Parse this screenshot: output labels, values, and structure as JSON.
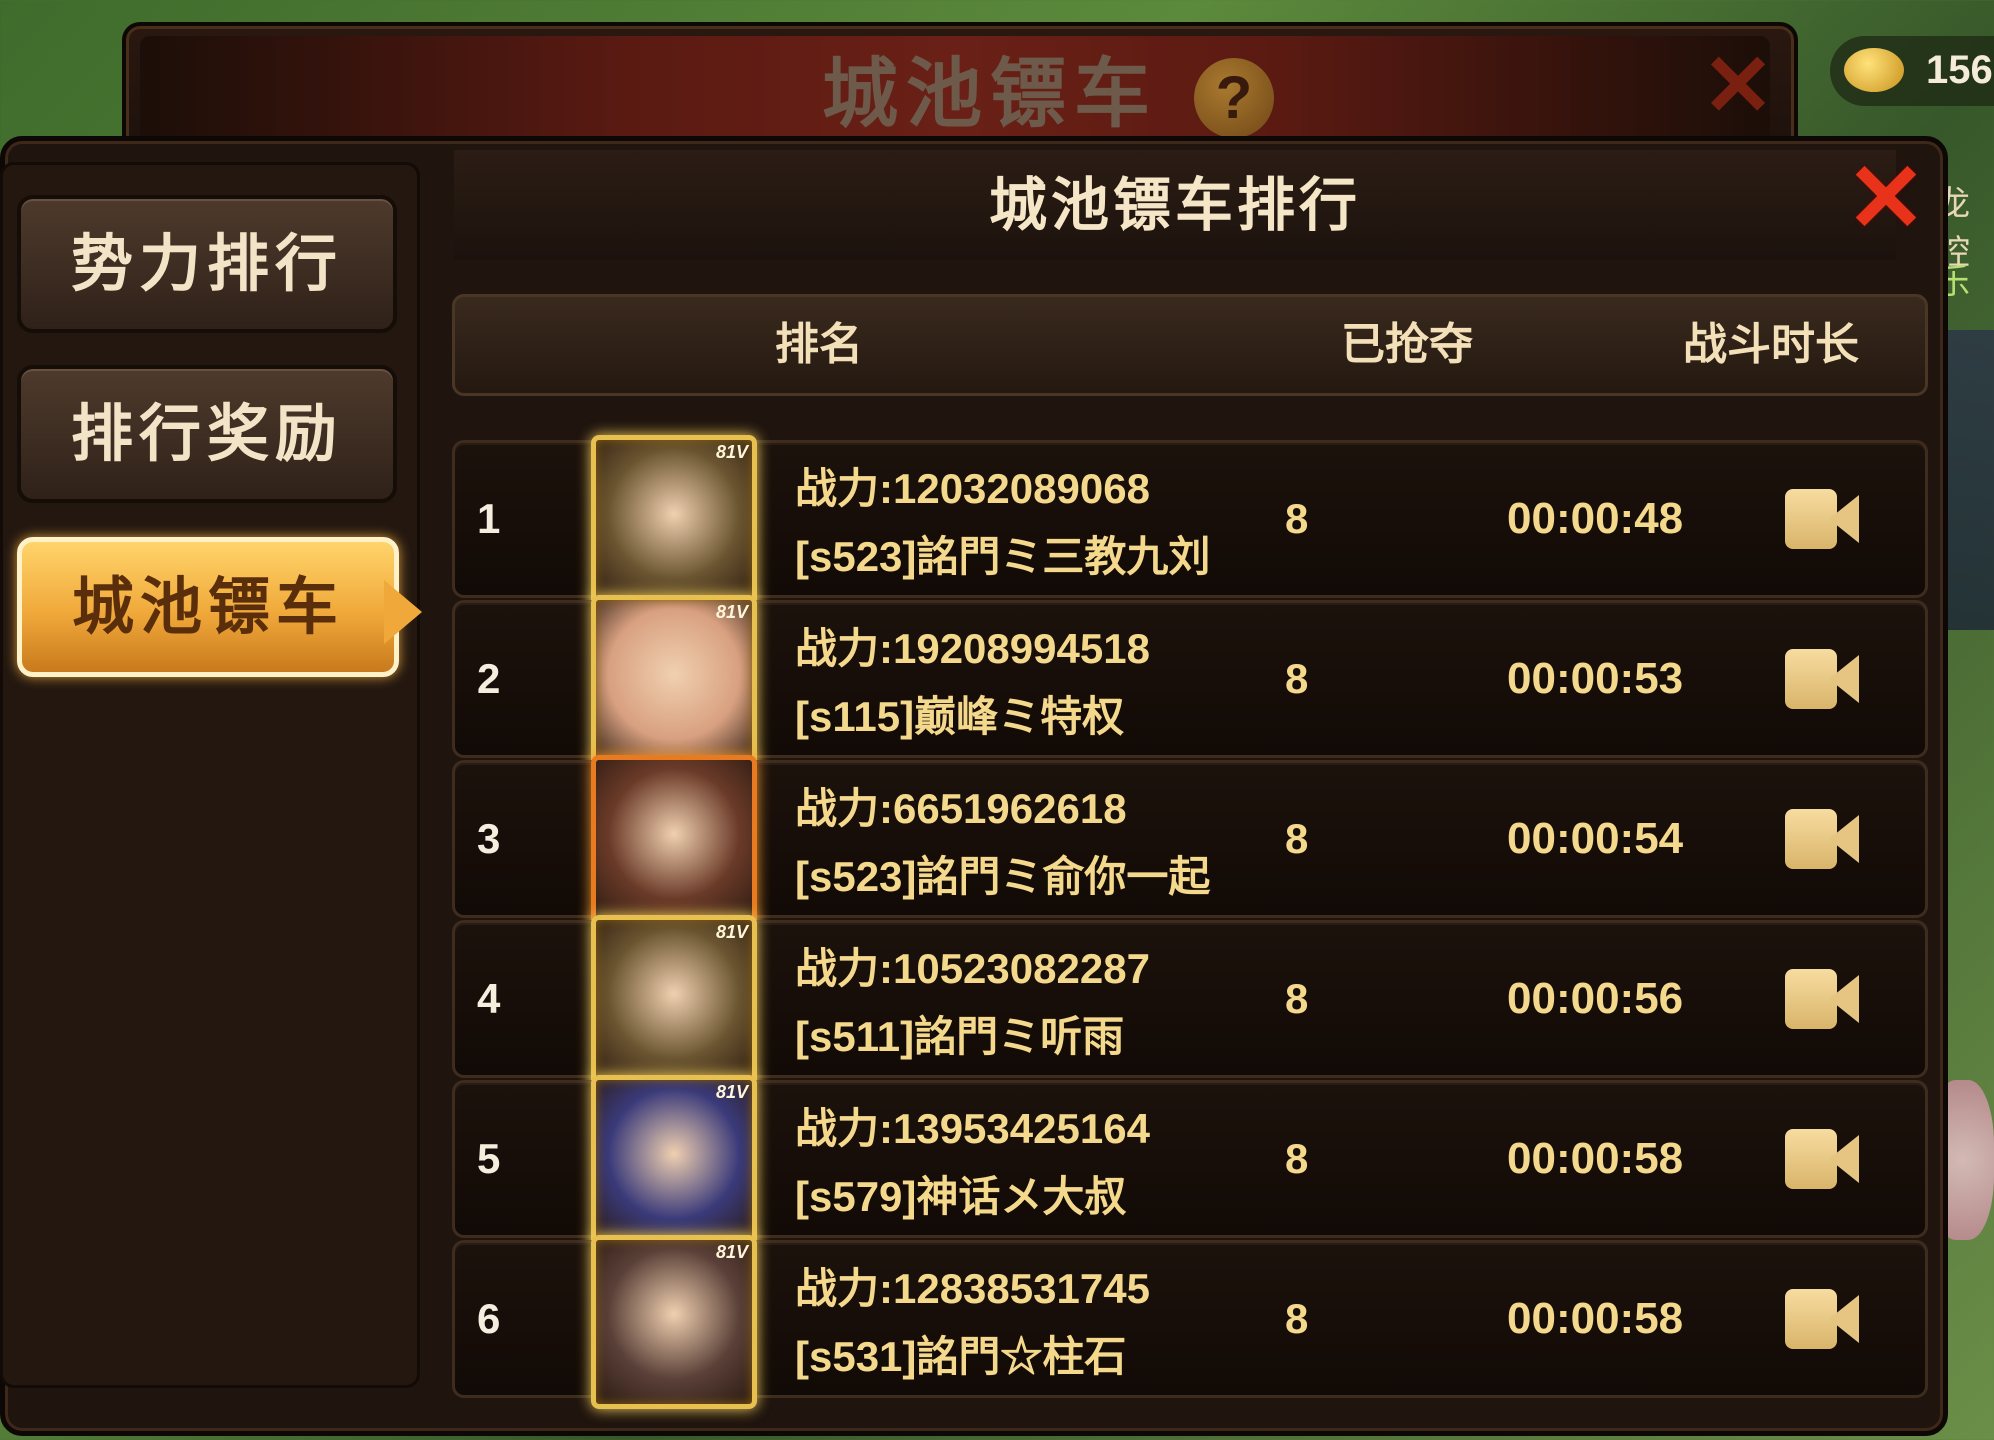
{
  "background_window": {
    "title": "城池镖车",
    "help_label": "?",
    "close_label": "✕"
  },
  "gold": {
    "icon": "gold-ingot-icon",
    "value": "156"
  },
  "side_peek": {
    "text1": "龙腔",
    "text2": "乐"
  },
  "nav": {
    "items": [
      {
        "label": "势力排行",
        "active": false
      },
      {
        "label": "排行奖励",
        "active": false
      },
      {
        "label": "城池镖车",
        "active": true
      }
    ]
  },
  "panel": {
    "title": "城池镖车排行",
    "close_label": "✕"
  },
  "columns": {
    "rank": "排名",
    "plundered": "已抢夺",
    "duration": "战斗时长"
  },
  "avatar_level": "81V",
  "rows": [
    {
      "rank": "1",
      "power": "战力:12032089068",
      "name": "[s523]詺門ミ三教九刘",
      "plundered": "8",
      "duration": "00:00:48",
      "avatar_color": "#6a5430"
    },
    {
      "rank": "2",
      "power": "战力:19208994518",
      "name": "[s115]巅峰ミ特权",
      "plundered": "8",
      "duration": "00:00:53",
      "avatar_color": "#d8a080"
    },
    {
      "rank": "3",
      "power": "战力:6651962618",
      "name": "[s523]詺門ミ俞你一起",
      "plundered": "8",
      "duration": "00:00:54",
      "avatar_color": "#6a3a28"
    },
    {
      "rank": "4",
      "power": "战力:10523082287",
      "name": "[s511]詺門ミ听雨",
      "plundered": "8",
      "duration": "00:00:56",
      "avatar_color": "#6a5430"
    },
    {
      "rank": "5",
      "power": "战力:13953425164",
      "name": "[s579]神话メ大叔",
      "plundered": "8",
      "duration": "00:00:58",
      "avatar_color": "#3a3a7a"
    },
    {
      "rank": "6",
      "power": "战力:12838531745",
      "name": "[s531]詺門☆柱石",
      "plundered": "8",
      "duration": "00:00:58",
      "avatar_color": "#5a4038"
    }
  ],
  "colors": {
    "accent_gold": "#f4d98c",
    "close_red": "#e8321a",
    "active_tab": "#f0a83a"
  },
  "icons": {
    "replay": "video-camera-icon",
    "help": "question-icon"
  }
}
